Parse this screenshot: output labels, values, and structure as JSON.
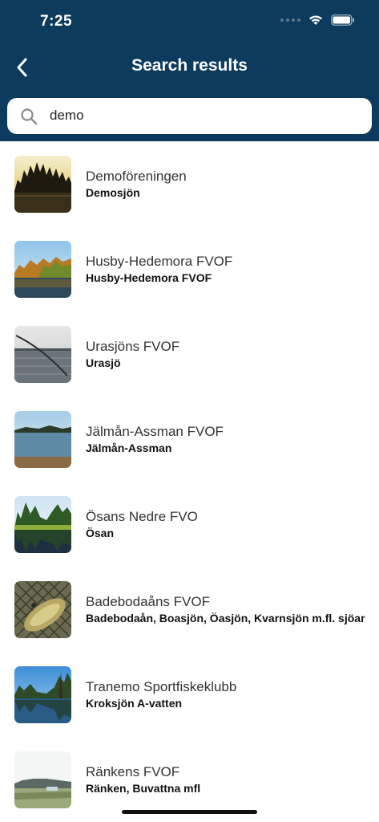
{
  "status": {
    "time": "7:25"
  },
  "nav": {
    "title": "Search results"
  },
  "search": {
    "value": "demo"
  },
  "results": [
    {
      "name": "Demoföreningen",
      "lakes": "Demosjön"
    },
    {
      "name": "Husby-Hedemora FVOF",
      "lakes": "Husby-Hedemora FVOF"
    },
    {
      "name": "Urasjöns FVOF",
      "lakes": "Urasjö"
    },
    {
      "name": "Jälmån-Assman FVOF",
      "lakes": "Jälmån-Assman"
    },
    {
      "name": "Ösans Nedre FVO",
      "lakes": "Ösan"
    },
    {
      "name": "Badebodaåns FVOF",
      "lakes": "Badebodaån, Boasjön, Öasjön, Kvarnsjön m.fl. sjöar"
    },
    {
      "name": "Tranemo Sportfiskeklubb",
      "lakes": "Kroksjön A-vatten"
    },
    {
      "name": "Ränkens FVOF",
      "lakes": "Ränken, Buvattna mfl"
    }
  ],
  "colors": {
    "header": "#0c3b5e",
    "accent": "#ffffff"
  },
  "icons": {
    "back": "chevron-left-icon",
    "search": "search-icon",
    "wifi": "wifi-icon",
    "battery": "battery-icon"
  }
}
